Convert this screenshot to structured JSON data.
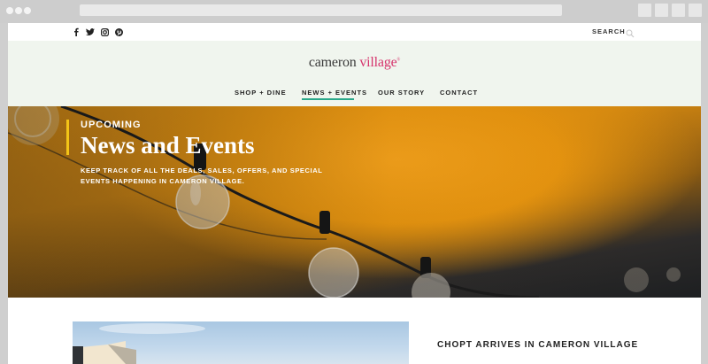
{
  "social": {
    "icons": [
      "facebook-icon",
      "twitter-icon",
      "instagram-icon",
      "pinterest-icon"
    ]
  },
  "search": {
    "label": "SEARCH"
  },
  "logo": {
    "part1": "cameron",
    "part2": "village",
    "mark": "®"
  },
  "nav": {
    "items": [
      {
        "label": "SHOP + DINE"
      },
      {
        "label": "NEWS + EVENTS",
        "active": true
      },
      {
        "label": "OUR STORY"
      },
      {
        "label": "CONTACT"
      }
    ]
  },
  "hero": {
    "kicker": "UPCOMING",
    "title": "News and Events",
    "description": "KEEP TRACK OF ALL THE DEALS, SALES, OFFERS, AND SPECIAL EVENTS HAPPENING IN CAMERON VILLAGE."
  },
  "article": {
    "title": "CHOPT ARRIVES IN CAMERON VILLAGE"
  },
  "colors": {
    "accent": "#2aa88a",
    "brand": "#d6336c",
    "hero_bar": "#f3c417",
    "header_bg": "#f0f5ee"
  }
}
